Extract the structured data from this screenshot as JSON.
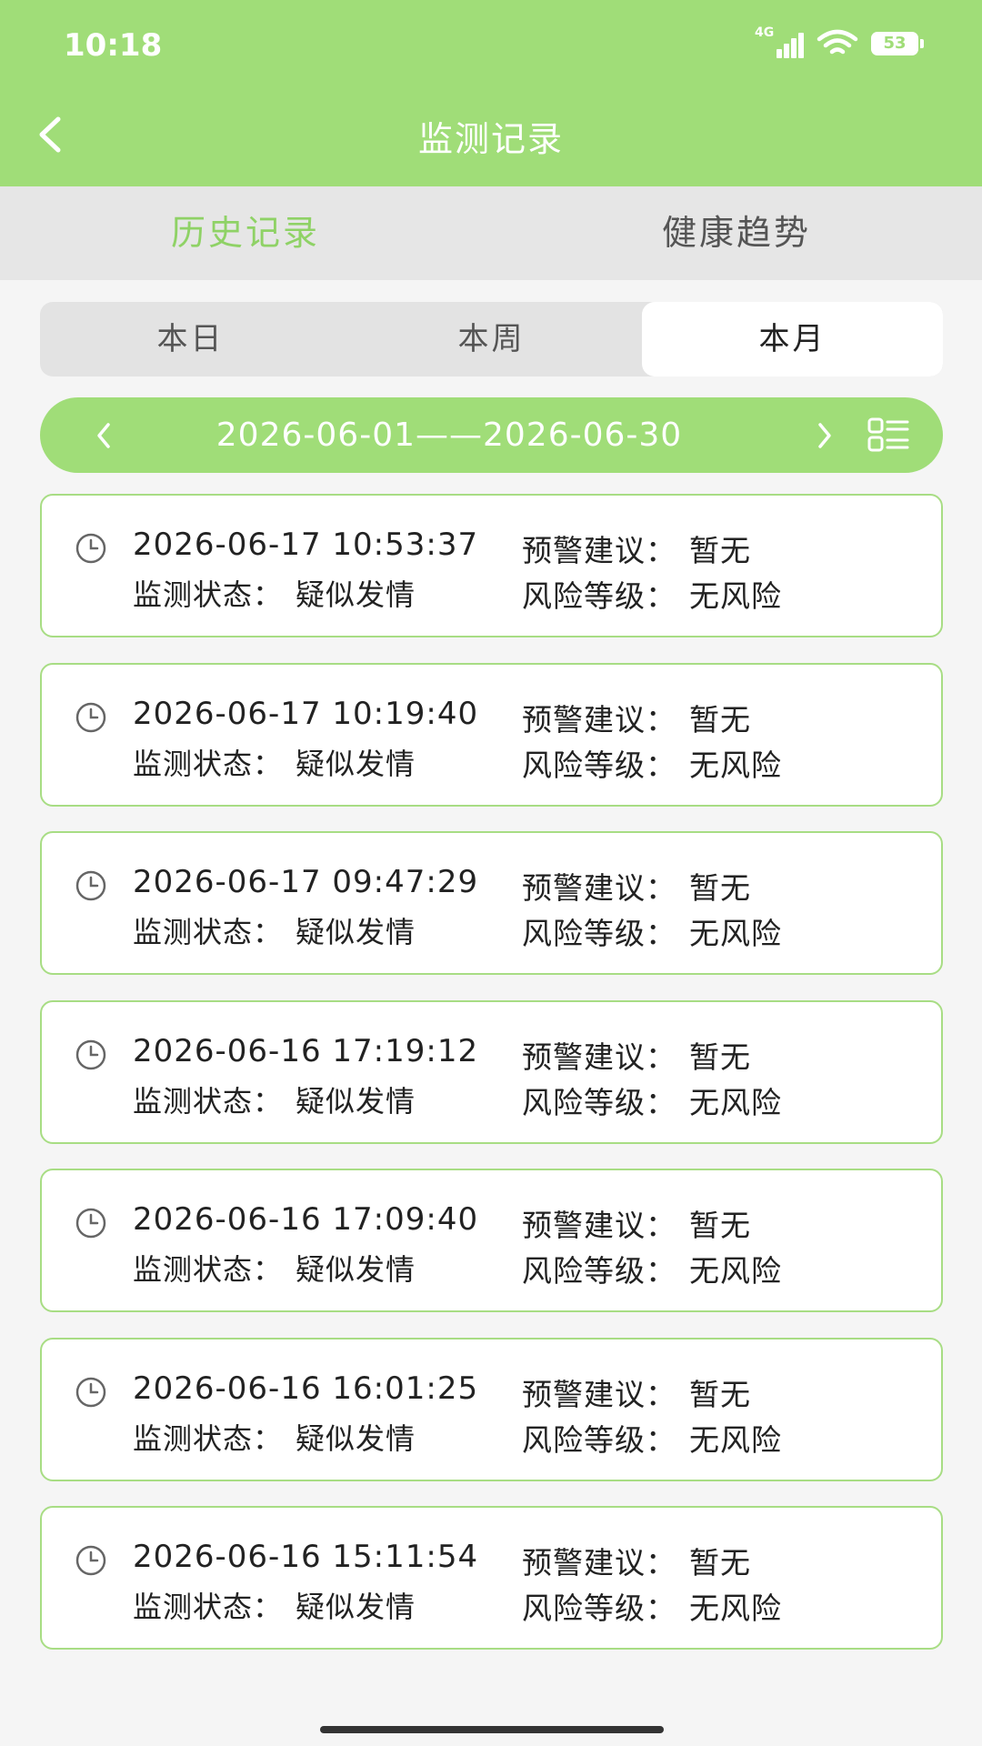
{
  "status": {
    "time": "10:18",
    "network": "4G",
    "battery": "53"
  },
  "nav": {
    "title": "监测记录"
  },
  "top_tabs": [
    {
      "label": "历史记录",
      "active": true
    },
    {
      "label": "健康趋势",
      "active": false
    }
  ],
  "period_tabs": [
    {
      "label": "本日",
      "active": false
    },
    {
      "label": "本周",
      "active": false
    },
    {
      "label": "本月",
      "active": true
    }
  ],
  "date_range": "2026-06-01——2026-06-30",
  "labels": {
    "warning": "预警建议：",
    "status": "监测状态：",
    "risk": "风险等级："
  },
  "records": [
    {
      "time": "2026-06-17 10:53:37",
      "warning": "暂无",
      "status": "疑似发情",
      "risk": "无风险"
    },
    {
      "time": "2026-06-17 10:19:40",
      "warning": "暂无",
      "status": "疑似发情",
      "risk": "无风险"
    },
    {
      "time": "2026-06-17 09:47:29",
      "warning": "暂无",
      "status": "疑似发情",
      "risk": "无风险"
    },
    {
      "time": "2026-06-16 17:19:12",
      "warning": "暂无",
      "status": "疑似发情",
      "risk": "无风险"
    },
    {
      "time": "2026-06-16 17:09:40",
      "warning": "暂无",
      "status": "疑似发情",
      "risk": "无风险"
    },
    {
      "time": "2026-06-16 16:01:25",
      "warning": "暂无",
      "status": "疑似发情",
      "risk": "无风险"
    },
    {
      "time": "2026-06-16 15:11:54",
      "warning": "暂无",
      "status": "疑似发情",
      "risk": "无风险"
    }
  ],
  "colors": {
    "accent": "#a0dd78",
    "active_tab": "#8fd266",
    "card_border": "#a8dd84"
  },
  "icons": [
    "back-icon",
    "signal-icon",
    "wifi-icon",
    "battery-icon",
    "chevron-left-icon",
    "chevron-right-icon",
    "list-view-icon",
    "clock-icon"
  ]
}
